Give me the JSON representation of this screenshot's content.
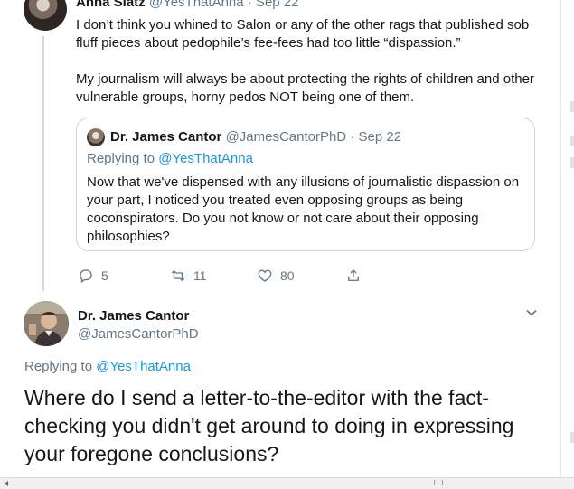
{
  "top_tweet": {
    "author_name": "Anna Slatz",
    "author_handle": "@YesThatAnna · Sep 22",
    "paragraph1": "I don’t think you whined to Salon or any of the other rags that published sob fluff pieces about pedophile’s fee-fees had too little “dispassion.”",
    "paragraph2": "My journalism will always be about protecting the rights of children and other vulnerable groups, horny pedos NOT being one of them.",
    "quote": {
      "author_name": "Dr. James Cantor",
      "author_handle": "@JamesCantorPhD · Sep 22",
      "replying_prefix": "Replying to ",
      "replying_handle": "@YesThatAnna",
      "text": "Now that we've dispensed with any illusions of journalistic dispassion on your part, I noticed you treated even opposing groups as being coconspirators.  Do you not know or not care about their opposing philosophies?"
    },
    "actions": {
      "replies": "5",
      "retweets": "11",
      "likes": "80"
    }
  },
  "main_tweet": {
    "author_name": "Dr. James Cantor",
    "author_handle": "@JamesCantorPhD",
    "replying_prefix": "Replying to ",
    "replying_handle": "@YesThatAnna",
    "text": "Where do I send a letter-to-the-editor with the fact-checking you didn't get around to doing in expressing your foregone conclusions?"
  },
  "colors": {
    "link": "#1b95e0",
    "secondary_text": "#657786",
    "border": "#ccd6dd"
  }
}
